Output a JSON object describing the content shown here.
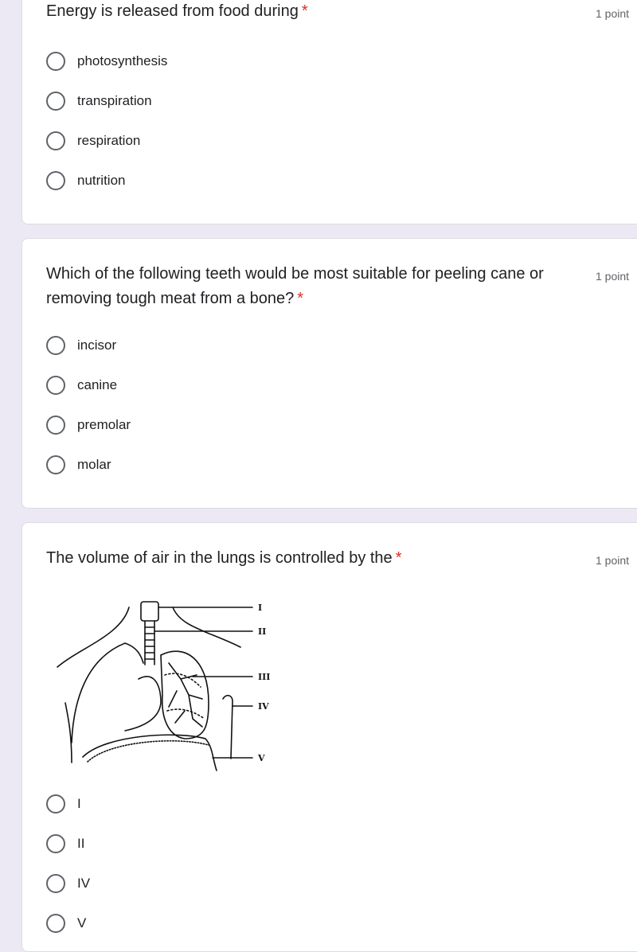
{
  "questions": [
    {
      "text": "Energy is released from food during",
      "required": "*",
      "points": "1 point",
      "options": [
        "photosynthesis",
        "transpiration",
        "respiration",
        "nutrition"
      ]
    },
    {
      "text": "Which of the following teeth would be most suitable for peeling cane or removing tough meat from a bone?",
      "required": "*",
      "points": "1 point",
      "options": [
        "incisor",
        "canine",
        "premolar",
        "molar"
      ]
    },
    {
      "text": "The volume of air in the lungs is controlled by the",
      "required": "*",
      "points": "1 point",
      "figure_labels": [
        "I",
        "II",
        "III",
        "IV",
        "V"
      ],
      "options": [
        "I",
        "II",
        "IV",
        "V"
      ]
    }
  ]
}
